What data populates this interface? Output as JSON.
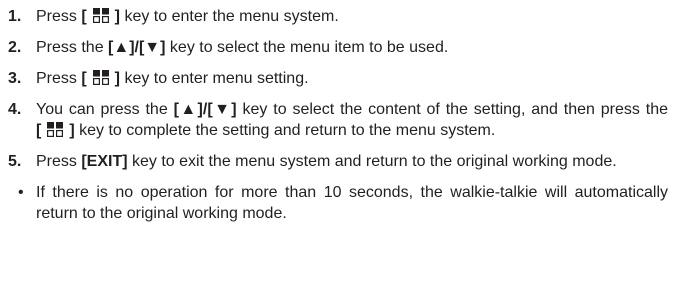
{
  "steps": [
    {
      "number": "1.",
      "parts": {
        "a": "Press ",
        "key_open": "[",
        "key_close": "]",
        "b": " key to enter the menu system."
      }
    },
    {
      "number": "2.",
      "parts": {
        "a": "Press the ",
        "keys": "[▲]/[▼]",
        "b": " key to select the menu item to be used."
      }
    },
    {
      "number": "3.",
      "parts": {
        "a": "Press ",
        "key_open": "[",
        "key_close": "]",
        "b": " key to enter menu setting."
      }
    },
    {
      "number": "4.",
      "parts": {
        "a": "You can press the ",
        "keys": "[▲]/[▼]",
        "b": " key to select the content of the setting, and then press the ",
        "key_open": "[",
        "key_close": "]",
        "c": " key to complete the setting and return to the menu system."
      }
    },
    {
      "number": "5.",
      "parts": {
        "a": "Press ",
        "keys": "[EXIT]",
        "b": " key to exit the menu system and return to the original working mode."
      }
    }
  ],
  "note": {
    "bullet": "•",
    "text": "If there is no operation for more than 10 seconds, the walkie-talkie will automatically return to the original working mode."
  },
  "icons": {
    "menu_key": "menu-grid-icon"
  },
  "colors": {
    "text": "#231f20"
  }
}
